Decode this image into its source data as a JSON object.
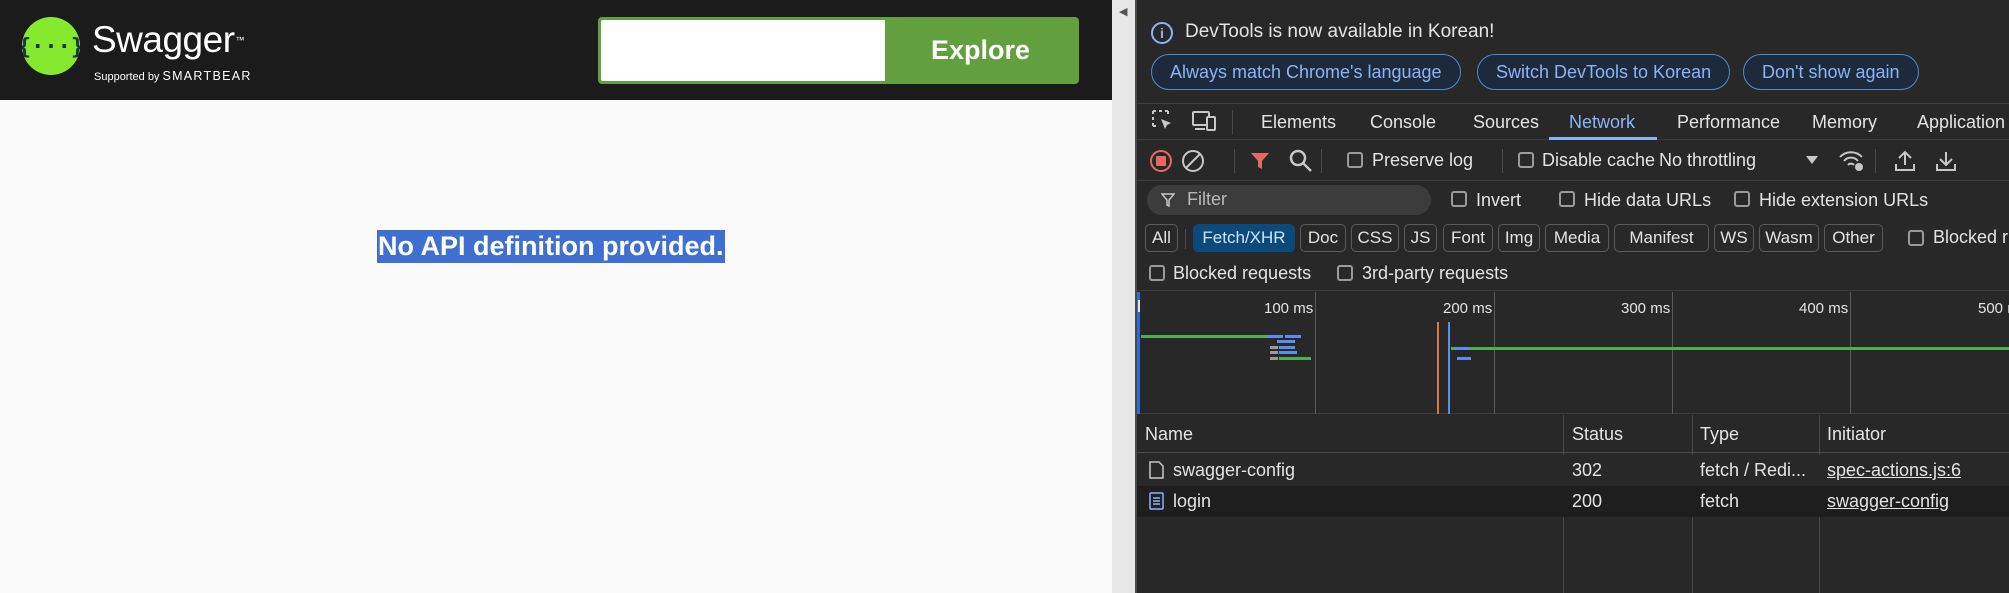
{
  "swagger": {
    "logo": {
      "word": "Swagger",
      "tm": "™",
      "supported_by": "Supported by",
      "brand": "SMARTBEAR"
    },
    "url_input": {
      "value": "",
      "placeholder": ""
    },
    "explore_label": "Explore",
    "message": "No API definition provided."
  },
  "devtools": {
    "infobar": {
      "text": "DevTools is now available in Korean!",
      "buttons": [
        "Always match Chrome's language",
        "Switch DevTools to Korean",
        "Don't show again"
      ]
    },
    "tabs": [
      "Elements",
      "Console",
      "Sources",
      "Network",
      "Performance",
      "Memory",
      "Application"
    ],
    "active_tab": "Network",
    "toolbar": {
      "preserve_log": "Preserve log",
      "disable_cache": "Disable cache",
      "throttling": "No throttling"
    },
    "filter": {
      "placeholder": "Filter",
      "invert": "Invert",
      "hide_data_urls": "Hide data URLs",
      "hide_extension_urls": "Hide extension URLs"
    },
    "type_filters": [
      "All",
      "Fetch/XHR",
      "Doc",
      "CSS",
      "JS",
      "Font",
      "Img",
      "Media",
      "Manifest",
      "WS",
      "Wasm",
      "Other"
    ],
    "active_type": "Fetch/XHR",
    "blocked_response_cookies": "Blocked r",
    "blocked_requests": "Blocked requests",
    "third_party_requests": "3rd-party requests",
    "timeline_ticks": [
      "100 ms",
      "200 ms",
      "300 ms",
      "400 ms",
      "500 ms"
    ],
    "table": {
      "columns": [
        "Name",
        "Status",
        "Type",
        "Initiator"
      ],
      "rows": [
        {
          "name": "swagger-config",
          "status": "302",
          "type": "fetch / Redi...",
          "initiator": "spec-actions.js:6",
          "icon": "document-icon"
        },
        {
          "name": "login",
          "status": "200",
          "type": "fetch",
          "initiator": "swagger-config",
          "icon": "text-file-icon"
        }
      ]
    },
    "colors": {
      "accent": "#8ab4f8",
      "record": "#e46962",
      "filter_active": "#e46962",
      "green": "#4caf50"
    }
  }
}
